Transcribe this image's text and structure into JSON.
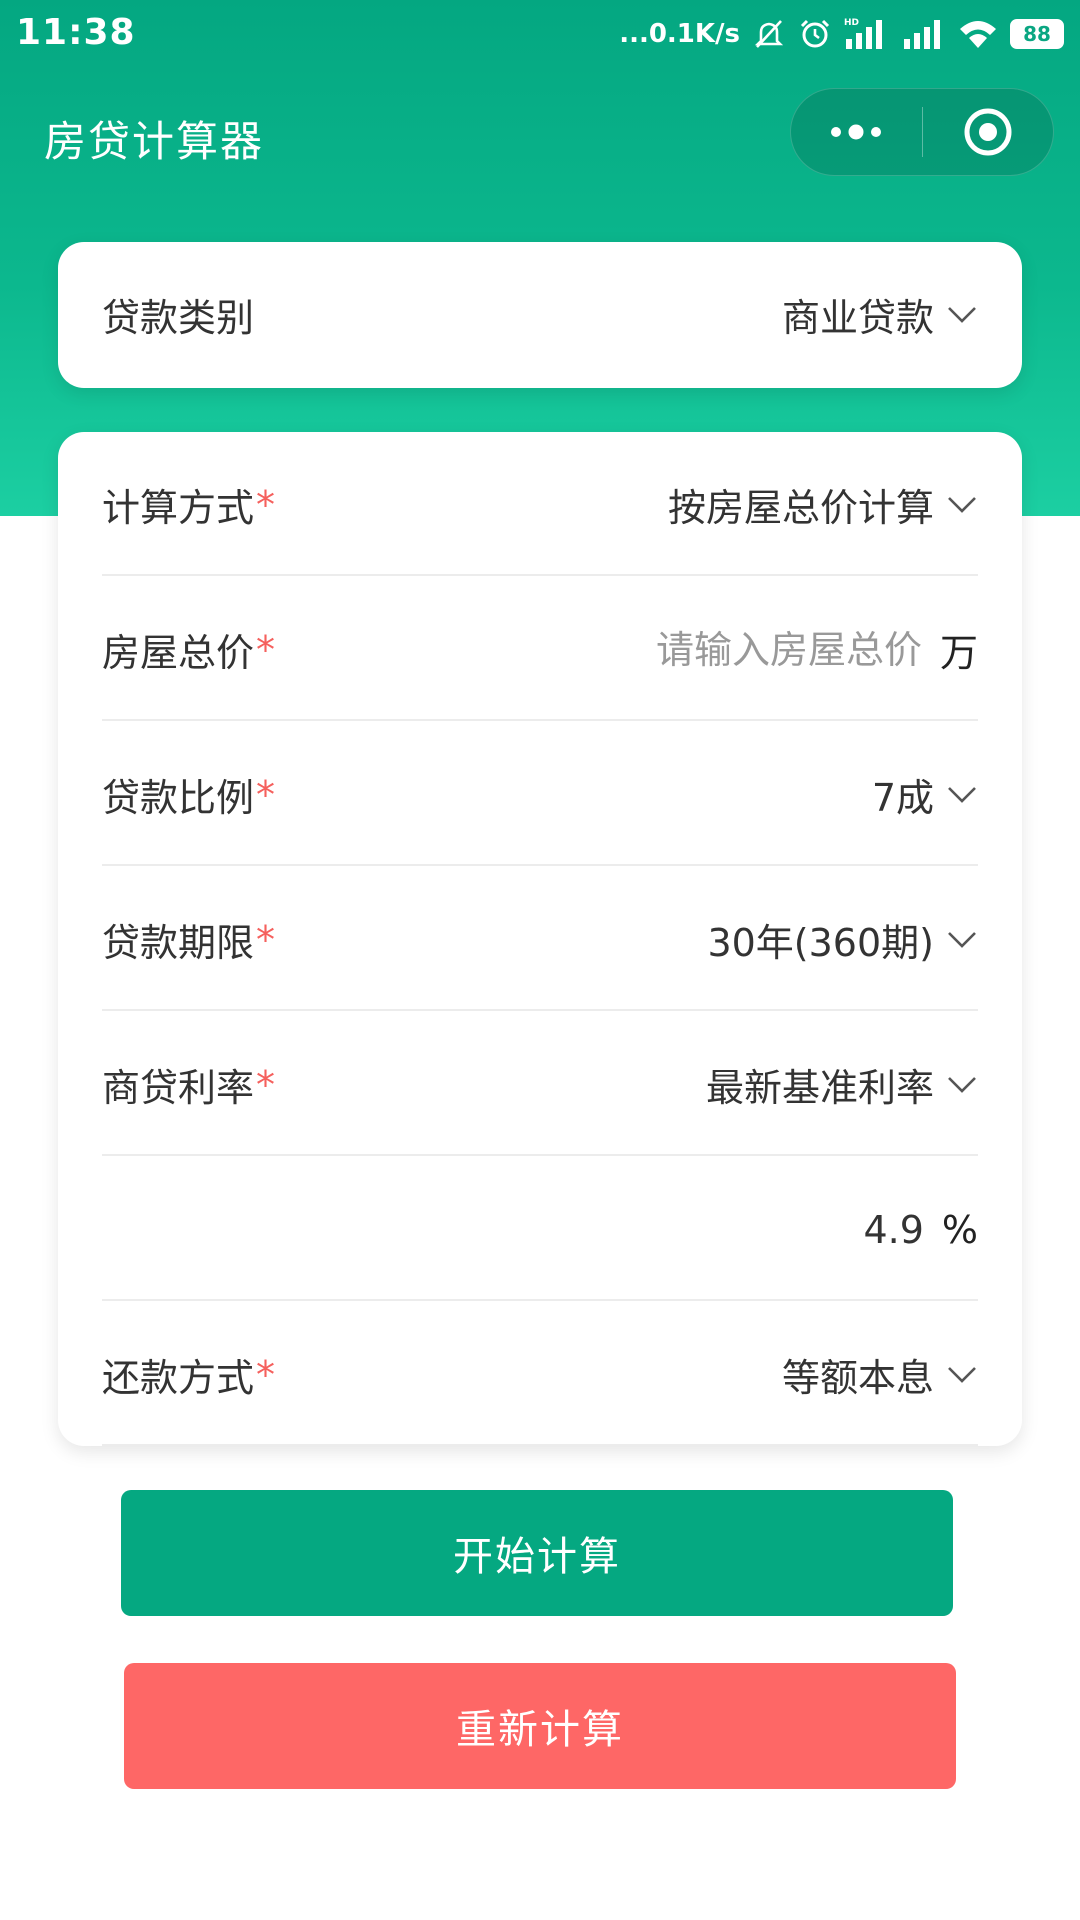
{
  "status_bar": {
    "time": "11:38",
    "net_speed": "...0.1K/s",
    "battery": "88",
    "icons": [
      "mute-icon",
      "alarm-icon",
      "signal-hd-icon",
      "signal-icon",
      "wifi-icon",
      "battery-icon"
    ]
  },
  "app": {
    "title": "房贷计算器"
  },
  "loan_type": {
    "label": "贷款类别",
    "value": "商业贷款"
  },
  "form": {
    "calc_method": {
      "label": "计算方式",
      "required": "*",
      "value": "按房屋总价计算"
    },
    "house_price": {
      "label": "房屋总价",
      "required": "*",
      "placeholder": "请输入房屋总价",
      "unit": "万"
    },
    "loan_ratio": {
      "label": "贷款比例",
      "required": "*",
      "value": "7成"
    },
    "loan_term": {
      "label": "贷款期限",
      "required": "*",
      "value": "30年(360期)"
    },
    "rate_type": {
      "label": "商贷利率",
      "required": "*",
      "value": "最新基准利率"
    },
    "rate_value": {
      "value": "4.9",
      "unit": "%"
    },
    "repay_method": {
      "label": "还款方式",
      "required": "*",
      "value": "等额本息"
    }
  },
  "buttons": {
    "calculate": "开始计算",
    "reset": "重新计算"
  },
  "colors": {
    "primary": "#05a881",
    "danger": "#fe6766",
    "required": "#f5605d",
    "placeholder": "#999999"
  }
}
